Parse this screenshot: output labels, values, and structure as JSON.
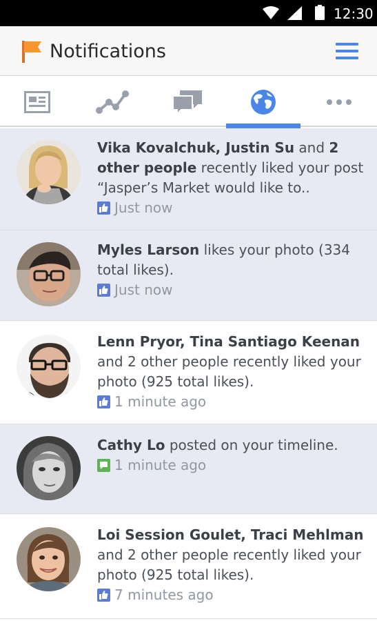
{
  "status_bar": {
    "time": "12:30"
  },
  "header": {
    "title": "Notifications"
  },
  "tabs": [
    {
      "name": "news-feed",
      "icon": "news-feed-icon"
    },
    {
      "name": "activity",
      "icon": "activity-graph-icon"
    },
    {
      "name": "messages",
      "icon": "messages-icon"
    },
    {
      "name": "notifications",
      "icon": "globe-icon",
      "active": true
    },
    {
      "name": "more",
      "icon": "more-icon"
    }
  ],
  "colors": {
    "accent": "#4a86e8",
    "unread_bg": "#e8eaf3",
    "like": "#5b7bd5",
    "comment": "#5ab552"
  },
  "notifications": [
    {
      "actors": "Vika Kovalchuk, Justin Su",
      "mid": " and ",
      "others": "2 other people",
      "rest": " recently liked your post “Jasper’s Market would like to..",
      "time": "Just now",
      "type_icon": "like-icon",
      "unread": true
    },
    {
      "actors": "Myles Larson",
      "rest": " likes your photo (334 total likes).",
      "time": "Just now",
      "type_icon": "like-icon",
      "unread": true
    },
    {
      "actors": "Lenn Pryor, Tina Santiago Keenan",
      "rest": "and 2 other people recently liked your photo (925 total likes).",
      "time": "1 minute ago",
      "type_icon": "like-icon",
      "unread": false
    },
    {
      "actors": "Cathy Lo",
      "rest": " posted on your timeline.",
      "time": "1 minute ago",
      "type_icon": "comment-icon",
      "unread": true
    },
    {
      "actors": "Loi Session Goulet, Traci Mehlman",
      "rest": " and 2 other people recently liked your photo (925 total likes).",
      "time": "7 minutes ago",
      "type_icon": "like-icon",
      "unread": false
    }
  ]
}
